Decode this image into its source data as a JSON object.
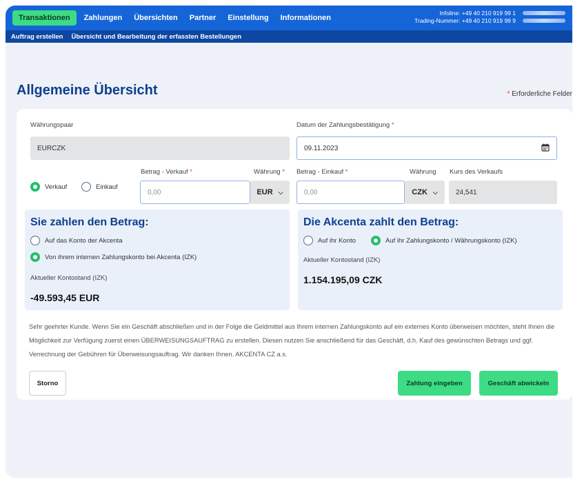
{
  "nav": {
    "items": [
      "Transaktionen",
      "Zahlungen",
      "Übersichten",
      "Partner",
      "Einstellung",
      "Informationen"
    ],
    "info_line1": "Infoline: +49 40 210 919 99 1",
    "info_line2": "Trading-Nummer: +49 40 210 919 99 9"
  },
  "subnav": {
    "items": [
      "Auftrag erstellen",
      "Übersicht und Bearbeitung der erfassten Bestellungen"
    ]
  },
  "page": {
    "title": "Allgemeine Übersicht",
    "required_note": "Erforderliche Felder",
    "required_star": "*"
  },
  "form": {
    "pair_label": "Währungspaar",
    "pair_value": "EURCZK",
    "date_label": "Datum der Zahlungsbestätigung",
    "date_value": "09.11.2023",
    "radio_sell": "Verkauf",
    "radio_buy": "Einkauf",
    "amount_sell_label": "Betrag - Verkauf",
    "amount_sell_placeholder": "0,00",
    "currency_sell_label": "Währung",
    "currency_sell_value": "EUR",
    "amount_buy_label": "Betrag - Einkauf",
    "amount_buy_placeholder": "0,00",
    "currency_buy_label": "Währung",
    "currency_buy_value": "CZK",
    "rate_label": "Kurs des Verkaufs",
    "rate_value": "24,541"
  },
  "pay_panel": {
    "title": "Sie zahlen den Betrag:",
    "opt1": "Auf das Konto der Akcenta",
    "opt2": "Von ihrem internen Zahlungskonto bei Akcenta (IZK)",
    "balance_label": "Aktueller Kontostand (IZK)",
    "balance_value": "-49.593,45 EUR"
  },
  "receive_panel": {
    "title": "Die Akcenta zahlt den Betrag:",
    "opt1": "Auf ihr Konto",
    "opt2": "Auf ihr Zahlungskonto / Währungskonto (IZK)",
    "balance_label": "Aktueller Kontostand (IZK)",
    "balance_value": "1.154.195,09 CZK"
  },
  "notice": "Sehr geehrter Kunde. Wenn Sie ein Geschäft abschließen und in der Folge die Geldmittel aus Ihrem internen Zahlungskonto auf ein externes Konto überweisen möchten, steht Ihnen die Möglichkeit zur Verfügung zuerst einen ÜBERWEISUNGSAUFTRAG zu erstellen. Diesen nutzen Sie anschließend für das Geschäft, d.h. Kauf des gewünschten Betrags und ggf. Verrechnung der Gebühren für Überweisungsauftrag. Wir danken Ihnen. AKCENTA CZ a.s.",
  "buttons": {
    "cancel": "Storno",
    "enter_payment": "Zahlung eingeben",
    "complete": "Geschäft abwickeln"
  },
  "colors": {
    "primary": "#1565d8",
    "subnav": "#0d47a1",
    "accent_green": "#3ddc84",
    "title_blue": "#0d3f8f",
    "required_red": "#e53935"
  }
}
